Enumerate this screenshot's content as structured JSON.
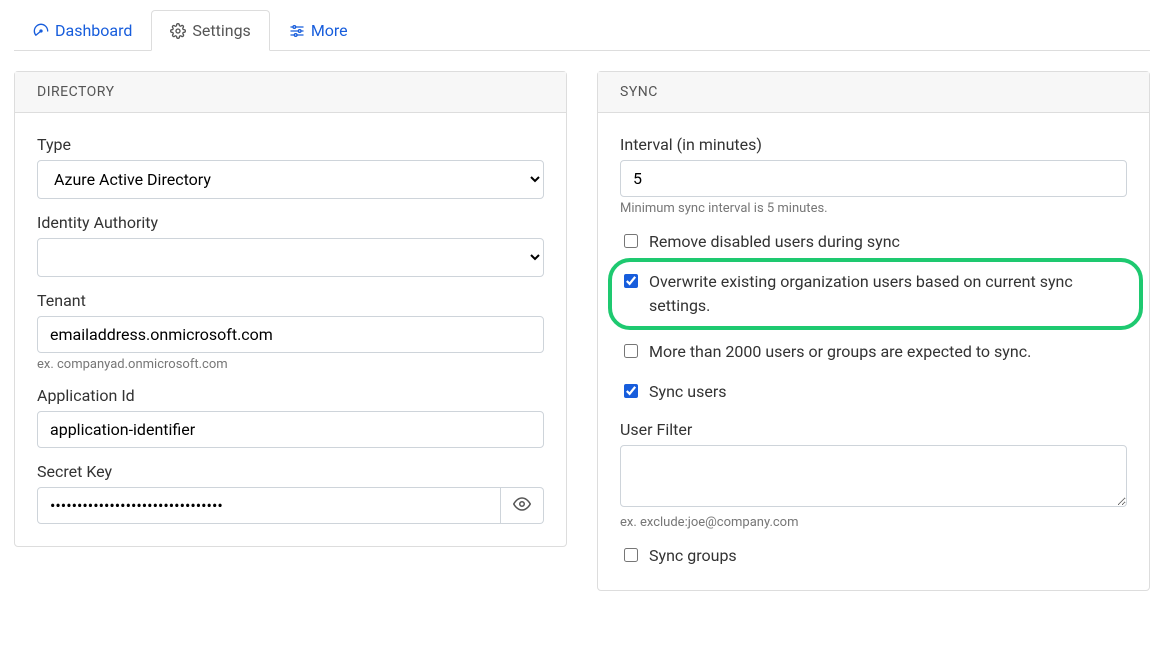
{
  "tabs": {
    "dashboard": "Dashboard",
    "settings": "Settings",
    "more": "More"
  },
  "directory": {
    "title": "DIRECTORY",
    "type_label": "Type",
    "type_value": "Azure Active Directory",
    "identity_label": "Identity Authority",
    "identity_value": "",
    "tenant_label": "Tenant",
    "tenant_value": "emailaddress.onmicrosoft.com",
    "tenant_help": "ex. companyad.onmicrosoft.com",
    "appid_label": "Application Id",
    "appid_value": "application-identifier",
    "secret_label": "Secret Key",
    "secret_value": "••••••••••••••••••••••••••••••••"
  },
  "sync": {
    "title": "SYNC",
    "interval_label": "Interval (in minutes)",
    "interval_value": "5",
    "interval_help": "Minimum sync interval is 5 minutes.",
    "remove_disabled_label": "Remove disabled users during sync",
    "remove_disabled_checked": false,
    "overwrite_label": "Overwrite existing organization users based on current sync settings.",
    "overwrite_checked": true,
    "large_import_label": "More than 2000 users or groups are expected to sync.",
    "large_import_checked": false,
    "sync_users_label": "Sync users",
    "sync_users_checked": true,
    "user_filter_label": "User Filter",
    "user_filter_value": "",
    "user_filter_help": "ex. exclude:joe@company.com",
    "sync_groups_label": "Sync groups",
    "sync_groups_checked": false
  }
}
